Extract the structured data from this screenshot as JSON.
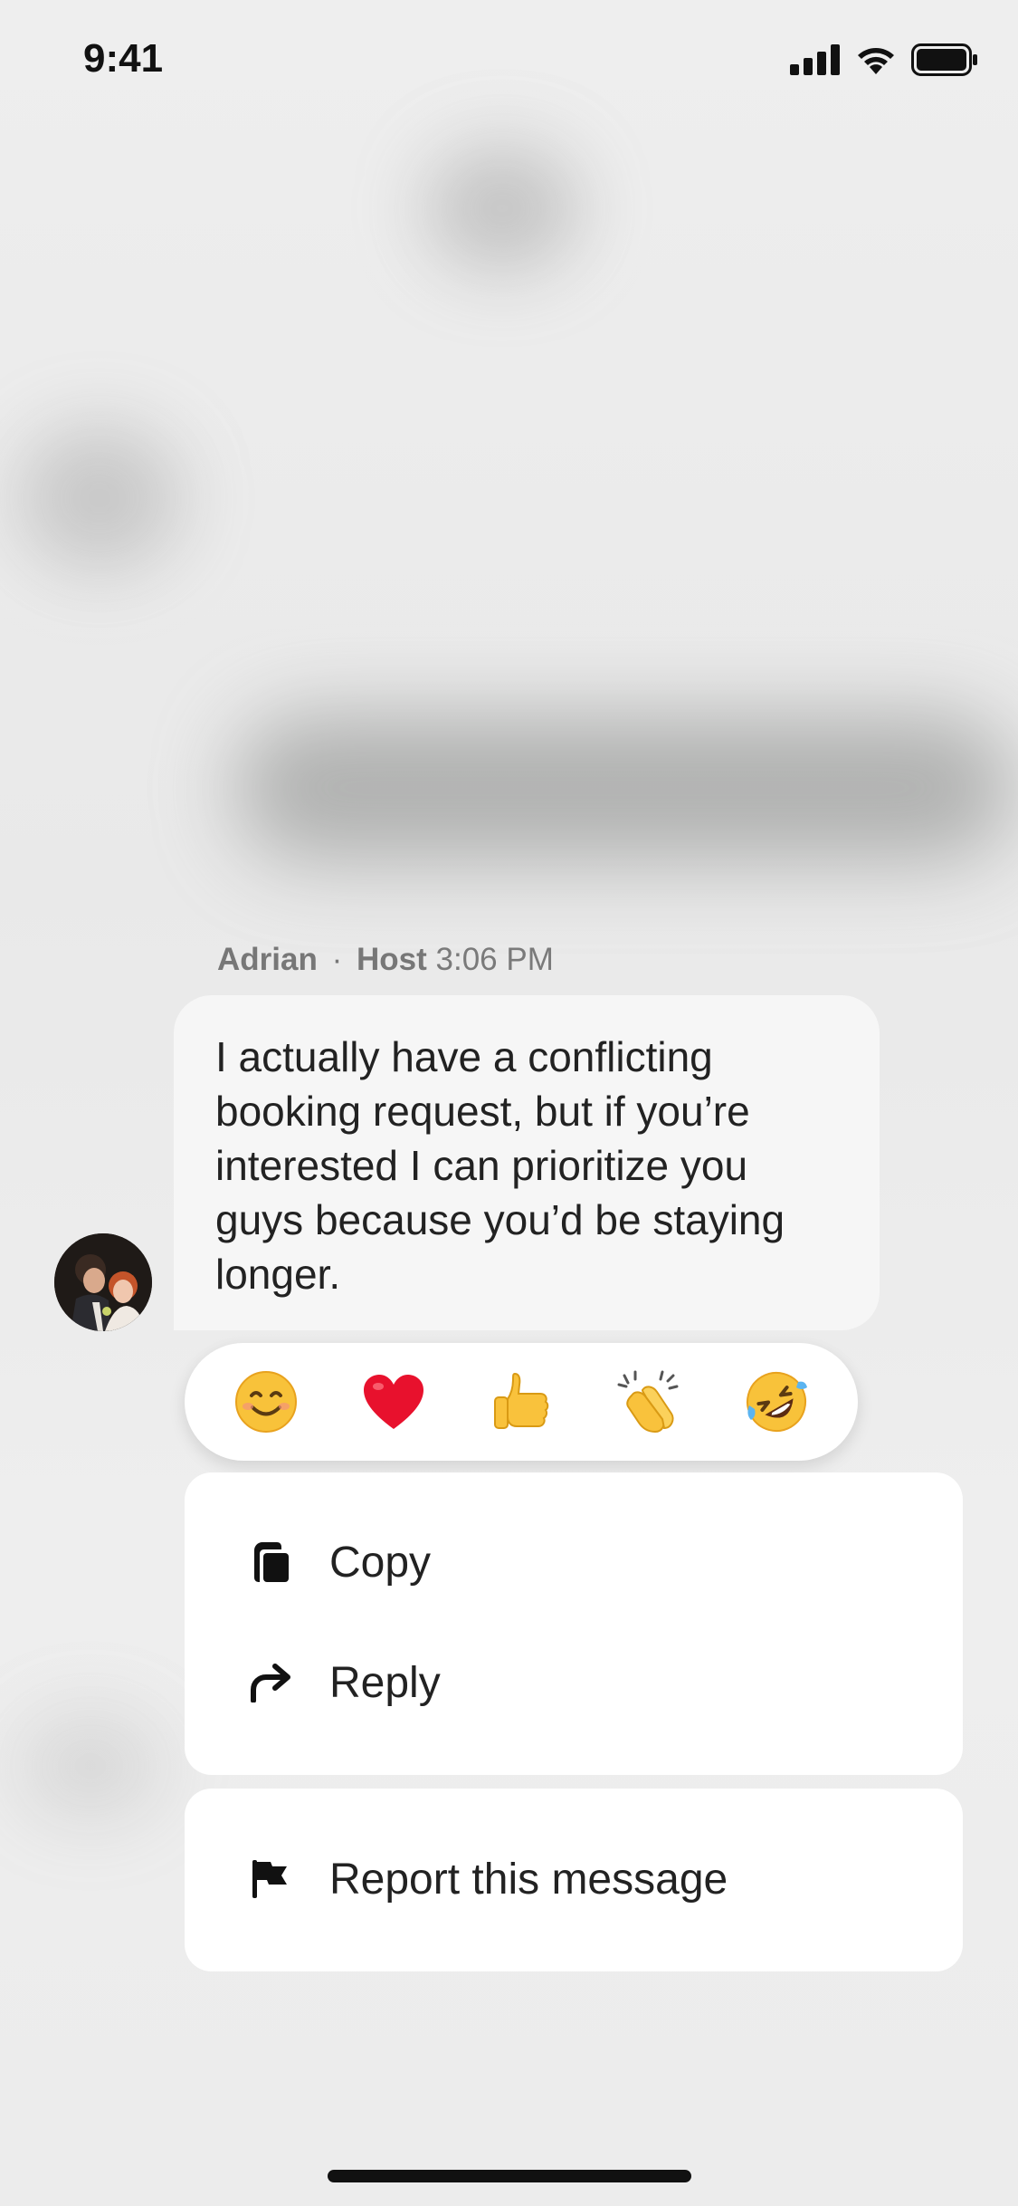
{
  "status_bar": {
    "time": "9:41",
    "icons": [
      "signal-icon",
      "wifi-icon",
      "battery-icon"
    ]
  },
  "message": {
    "sender": "Adrian",
    "separator": "·",
    "role": "Host",
    "time": "3:06 PM",
    "text": "I actually have a conflicting booking request, but if you’re interested I can prioritize you guys because you’d be staying longer."
  },
  "reactions": [
    {
      "name": "smiling-face",
      "glyph": "😊"
    },
    {
      "name": "red-heart",
      "glyph": "❤️"
    },
    {
      "name": "thumbs-up",
      "glyph": "👍"
    },
    {
      "name": "clapping-hands",
      "glyph": "👏"
    },
    {
      "name": "rolling-on-floor-laughing",
      "glyph": "🤣"
    }
  ],
  "menu": {
    "copy_label": "Copy",
    "reply_label": "Reply",
    "report_label": "Report this message"
  },
  "colors": {
    "background": "#ececec",
    "bubble": "#f6f6f6",
    "text": "#222222",
    "meta": "#7a7a7a"
  }
}
